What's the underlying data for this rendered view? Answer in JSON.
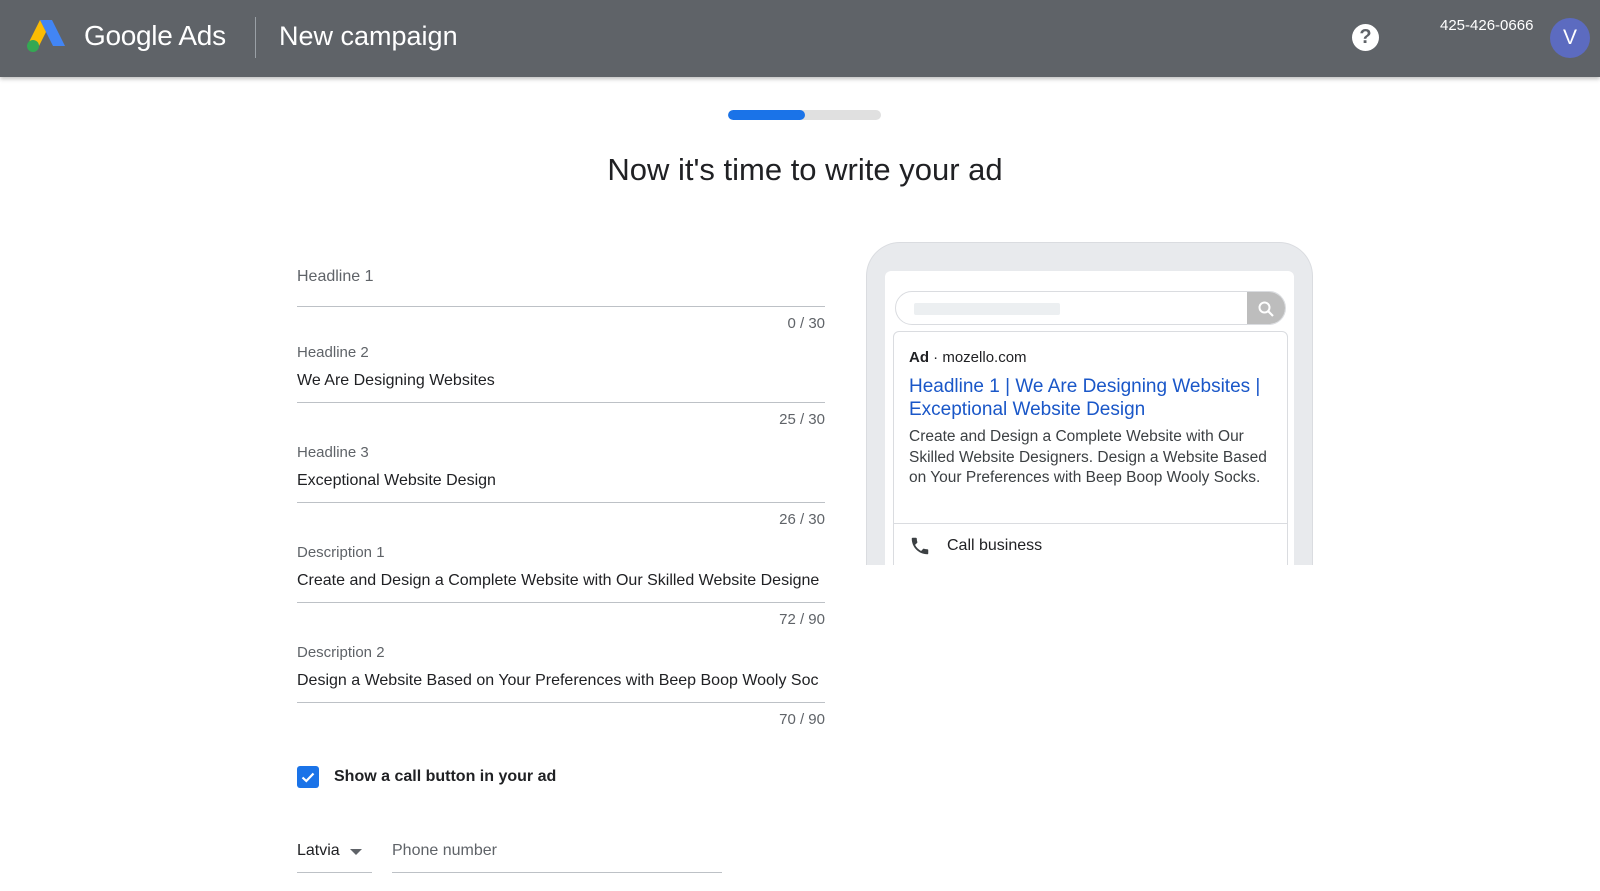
{
  "header": {
    "brand": "Google Ads",
    "title": "New campaign",
    "help_symbol": "?",
    "phone": "425-426-0666",
    "avatar_initial": "V",
    "colors": {
      "bar": "#5f6368",
      "avatar": "#5c6bc0"
    }
  },
  "progress": {
    "fraction": 0.5
  },
  "heading": "Now it's time to write your ad",
  "fields": {
    "headline1": {
      "label": "Headline 1",
      "value": "",
      "counter": "0 / 30"
    },
    "headline2": {
      "label": "Headline 2",
      "value": "We Are Designing Websites",
      "counter": "25 / 30"
    },
    "headline3": {
      "label": "Headline 3",
      "value": "Exceptional Website Design",
      "counter": "26 / 30"
    },
    "description1": {
      "label": "Description 1",
      "value": "Create and Design a Complete Website with Our Skilled Website Designe",
      "counter": "72 / 90"
    },
    "description2": {
      "label": "Description 2",
      "value": "Design a Website Based on Your Preferences with Beep Boop Wooly Soc",
      "counter": "70 / 90"
    }
  },
  "call_button": {
    "label": "Show a call button in your ad",
    "checked": true
  },
  "phone_entry": {
    "country": "Latvia",
    "placeholder": "Phone number"
  },
  "preview": {
    "ad_badge": "Ad",
    "separator": "·",
    "domain": "mozello.com",
    "headline": "Headline 1 | We Are Designing Websites | Exceptional Website Design",
    "description": "Create and Design a Complete Website with Our Skilled Website Designers. Design a Website Based on Your Preferences with Beep Boop Wooly Socks.",
    "call_label": "Call business",
    "icons": [
      "search-icon",
      "phone-icon"
    ]
  }
}
